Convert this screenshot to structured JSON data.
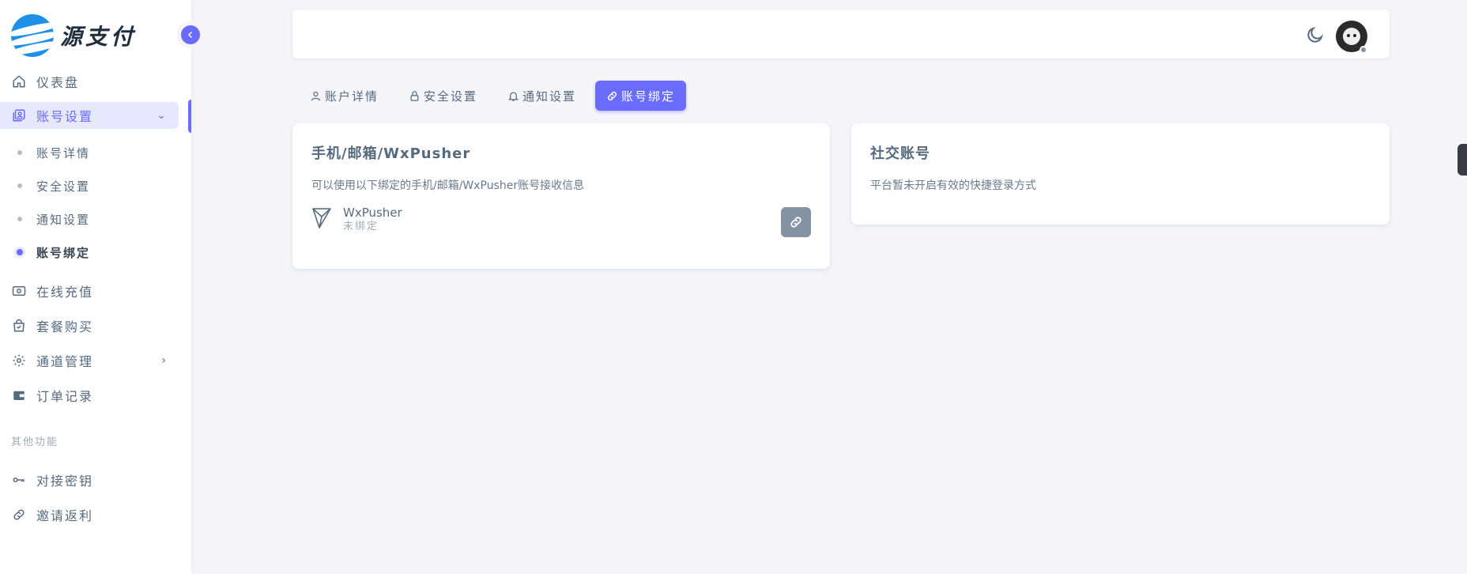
{
  "brand": {
    "name": "源支付",
    "logo_icon": "source-pay-logo-icon"
  },
  "sidebar": {
    "items": [
      {
        "label": "仪表盘",
        "icon": "home-icon"
      },
      {
        "label": "账号设置",
        "icon": "account-box-icon",
        "open": true
      },
      {
        "label": "在线充值",
        "icon": "money-icon"
      },
      {
        "label": "套餐购买",
        "icon": "shopping-bag-icon"
      },
      {
        "label": "通道管理",
        "icon": "gear-icon"
      },
      {
        "label": "订单记录",
        "icon": "wallet-icon"
      }
    ],
    "submenu": [
      {
        "label": "账号详情"
      },
      {
        "label": "安全设置"
      },
      {
        "label": "通知设置"
      },
      {
        "label": "账号绑定",
        "active": true
      }
    ],
    "section_header": "其他功能",
    "other_items": [
      {
        "label": "对接密钥",
        "icon": "key-icon"
      },
      {
        "label": "邀请返利",
        "icon": "link-icon"
      }
    ]
  },
  "tabs": [
    {
      "label": "账户详情",
      "icon": "user-icon"
    },
    {
      "label": "安全设置",
      "icon": "lock-icon"
    },
    {
      "label": "通知设置",
      "icon": "bell-icon"
    },
    {
      "label": "账号绑定",
      "icon": "link-icon",
      "active": true
    }
  ],
  "cards": {
    "contact": {
      "title": "手机/邮箱/WxPusher",
      "description": "可以使用以下绑定的手机/邮箱/WxPusher账号接收信息",
      "items": [
        {
          "name": "WxPusher",
          "status": "未绑定",
          "icon": "wxpusher-icon",
          "action_icon": "link-icon"
        }
      ]
    },
    "social": {
      "title": "社交账号",
      "description": "平台暂未开启有效的快捷登录方式"
    }
  },
  "colors": {
    "primary": "#696cff",
    "primary_light": "#e7e7ff",
    "secondary": "#8592a3",
    "background": "#f5f5f9",
    "text": "#566a7f"
  }
}
